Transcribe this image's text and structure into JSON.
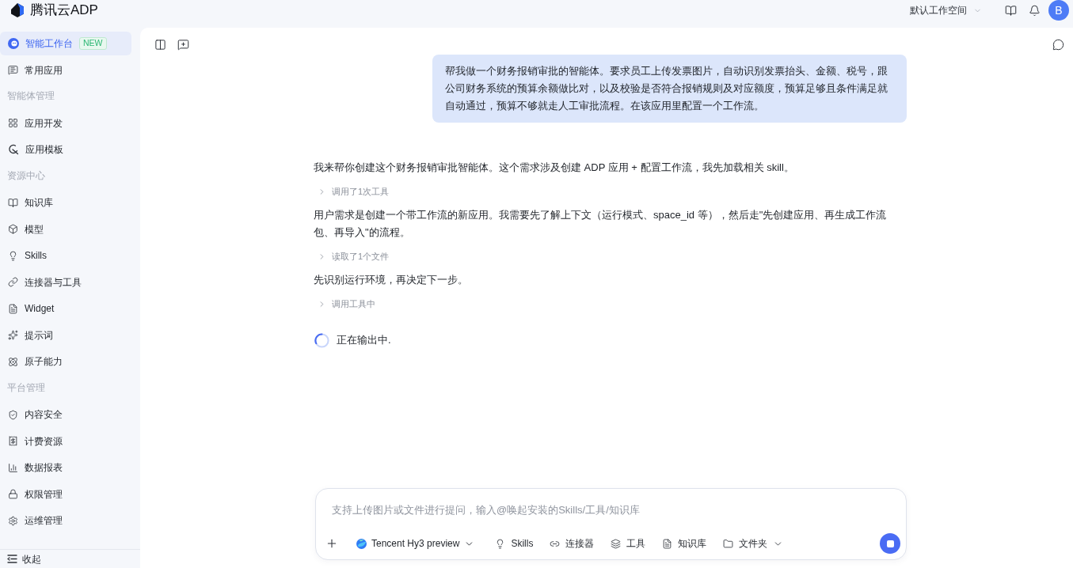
{
  "header": {
    "logo": "腾讯云ADP",
    "workspace": "默认工作空间",
    "avatar": "B"
  },
  "sidebar": {
    "items": [
      {
        "kind": "item",
        "label": "智能工作台",
        "badge": "NEW",
        "selected": true
      },
      {
        "kind": "item",
        "label": "常用应用",
        "selected": false
      },
      {
        "kind": "section",
        "label": "智能体管理"
      },
      {
        "kind": "item",
        "label": "应用开发",
        "selected": false
      },
      {
        "kind": "item",
        "label": "应用模板",
        "selected": false
      },
      {
        "kind": "section",
        "label": "资源中心"
      },
      {
        "kind": "item",
        "label": "知识库",
        "selected": false
      },
      {
        "kind": "item",
        "label": "模型",
        "selected": false
      },
      {
        "kind": "item",
        "label": "Skills",
        "selected": false
      },
      {
        "kind": "item",
        "label": "连接器与工具",
        "selected": false
      },
      {
        "kind": "item",
        "label": "Widget",
        "selected": false
      },
      {
        "kind": "item",
        "label": "提示词",
        "selected": false
      },
      {
        "kind": "item",
        "label": "原子能力",
        "selected": false
      },
      {
        "kind": "section",
        "label": "平台管理"
      },
      {
        "kind": "item",
        "label": "内容安全",
        "selected": false
      },
      {
        "kind": "item",
        "label": "计费资源",
        "selected": false
      },
      {
        "kind": "item",
        "label": "数据报表",
        "selected": false
      },
      {
        "kind": "item",
        "label": "权限管理",
        "selected": false
      },
      {
        "kind": "item",
        "label": "运维管理",
        "selected": false
      }
    ],
    "collapse": "收起"
  },
  "chat": {
    "user_message": "帮我做一个财务报销审批的智能体。要求员工上传发票图片，自动识别发票抬头、金额、税号，跟公司财务系统的预算余额做比对，以及校验是否符合报销规则及对应额度，预算足够且条件满足就自动通过，预算不够就走人工审批流程。在该应用里配置一个工作流。",
    "assistant": [
      {
        "kind": "text",
        "text": "我来帮你创建这个财务报销审批智能体。这个需求涉及创建 ADP 应用 + 配置工作流，我先加载相关 skill。"
      },
      {
        "kind": "step",
        "text": "调用了1次工具",
        "expanded": false
      },
      {
        "kind": "text",
        "text": "用户需求是创建一个带工作流的新应用。我需要先了解上下文（运行模式、space_id 等），然后走\"先创建应用、再生成工作流包、再导入\"的流程。"
      },
      {
        "kind": "step",
        "text": "读取了1个文件",
        "expanded": false
      },
      {
        "kind": "text",
        "text": "先识别运行环境，再决定下一步。"
      },
      {
        "kind": "step",
        "text": "调用工具中",
        "expanded": false
      }
    ],
    "status": "正在输出中."
  },
  "composer": {
    "placeholder": "支持上传图片或文件进行提问，输入@唤起安装的Skills/工具/知识库",
    "model": "Tencent Hy3 preview",
    "tools": [
      {
        "label": "Skills",
        "kind": "toggle"
      },
      {
        "label": "连接器",
        "kind": "toggle"
      },
      {
        "label": "工具",
        "kind": "toggle"
      },
      {
        "label": "知识库",
        "kind": "toggle"
      },
      {
        "label": "文件夹",
        "kind": "menu"
      }
    ]
  }
}
